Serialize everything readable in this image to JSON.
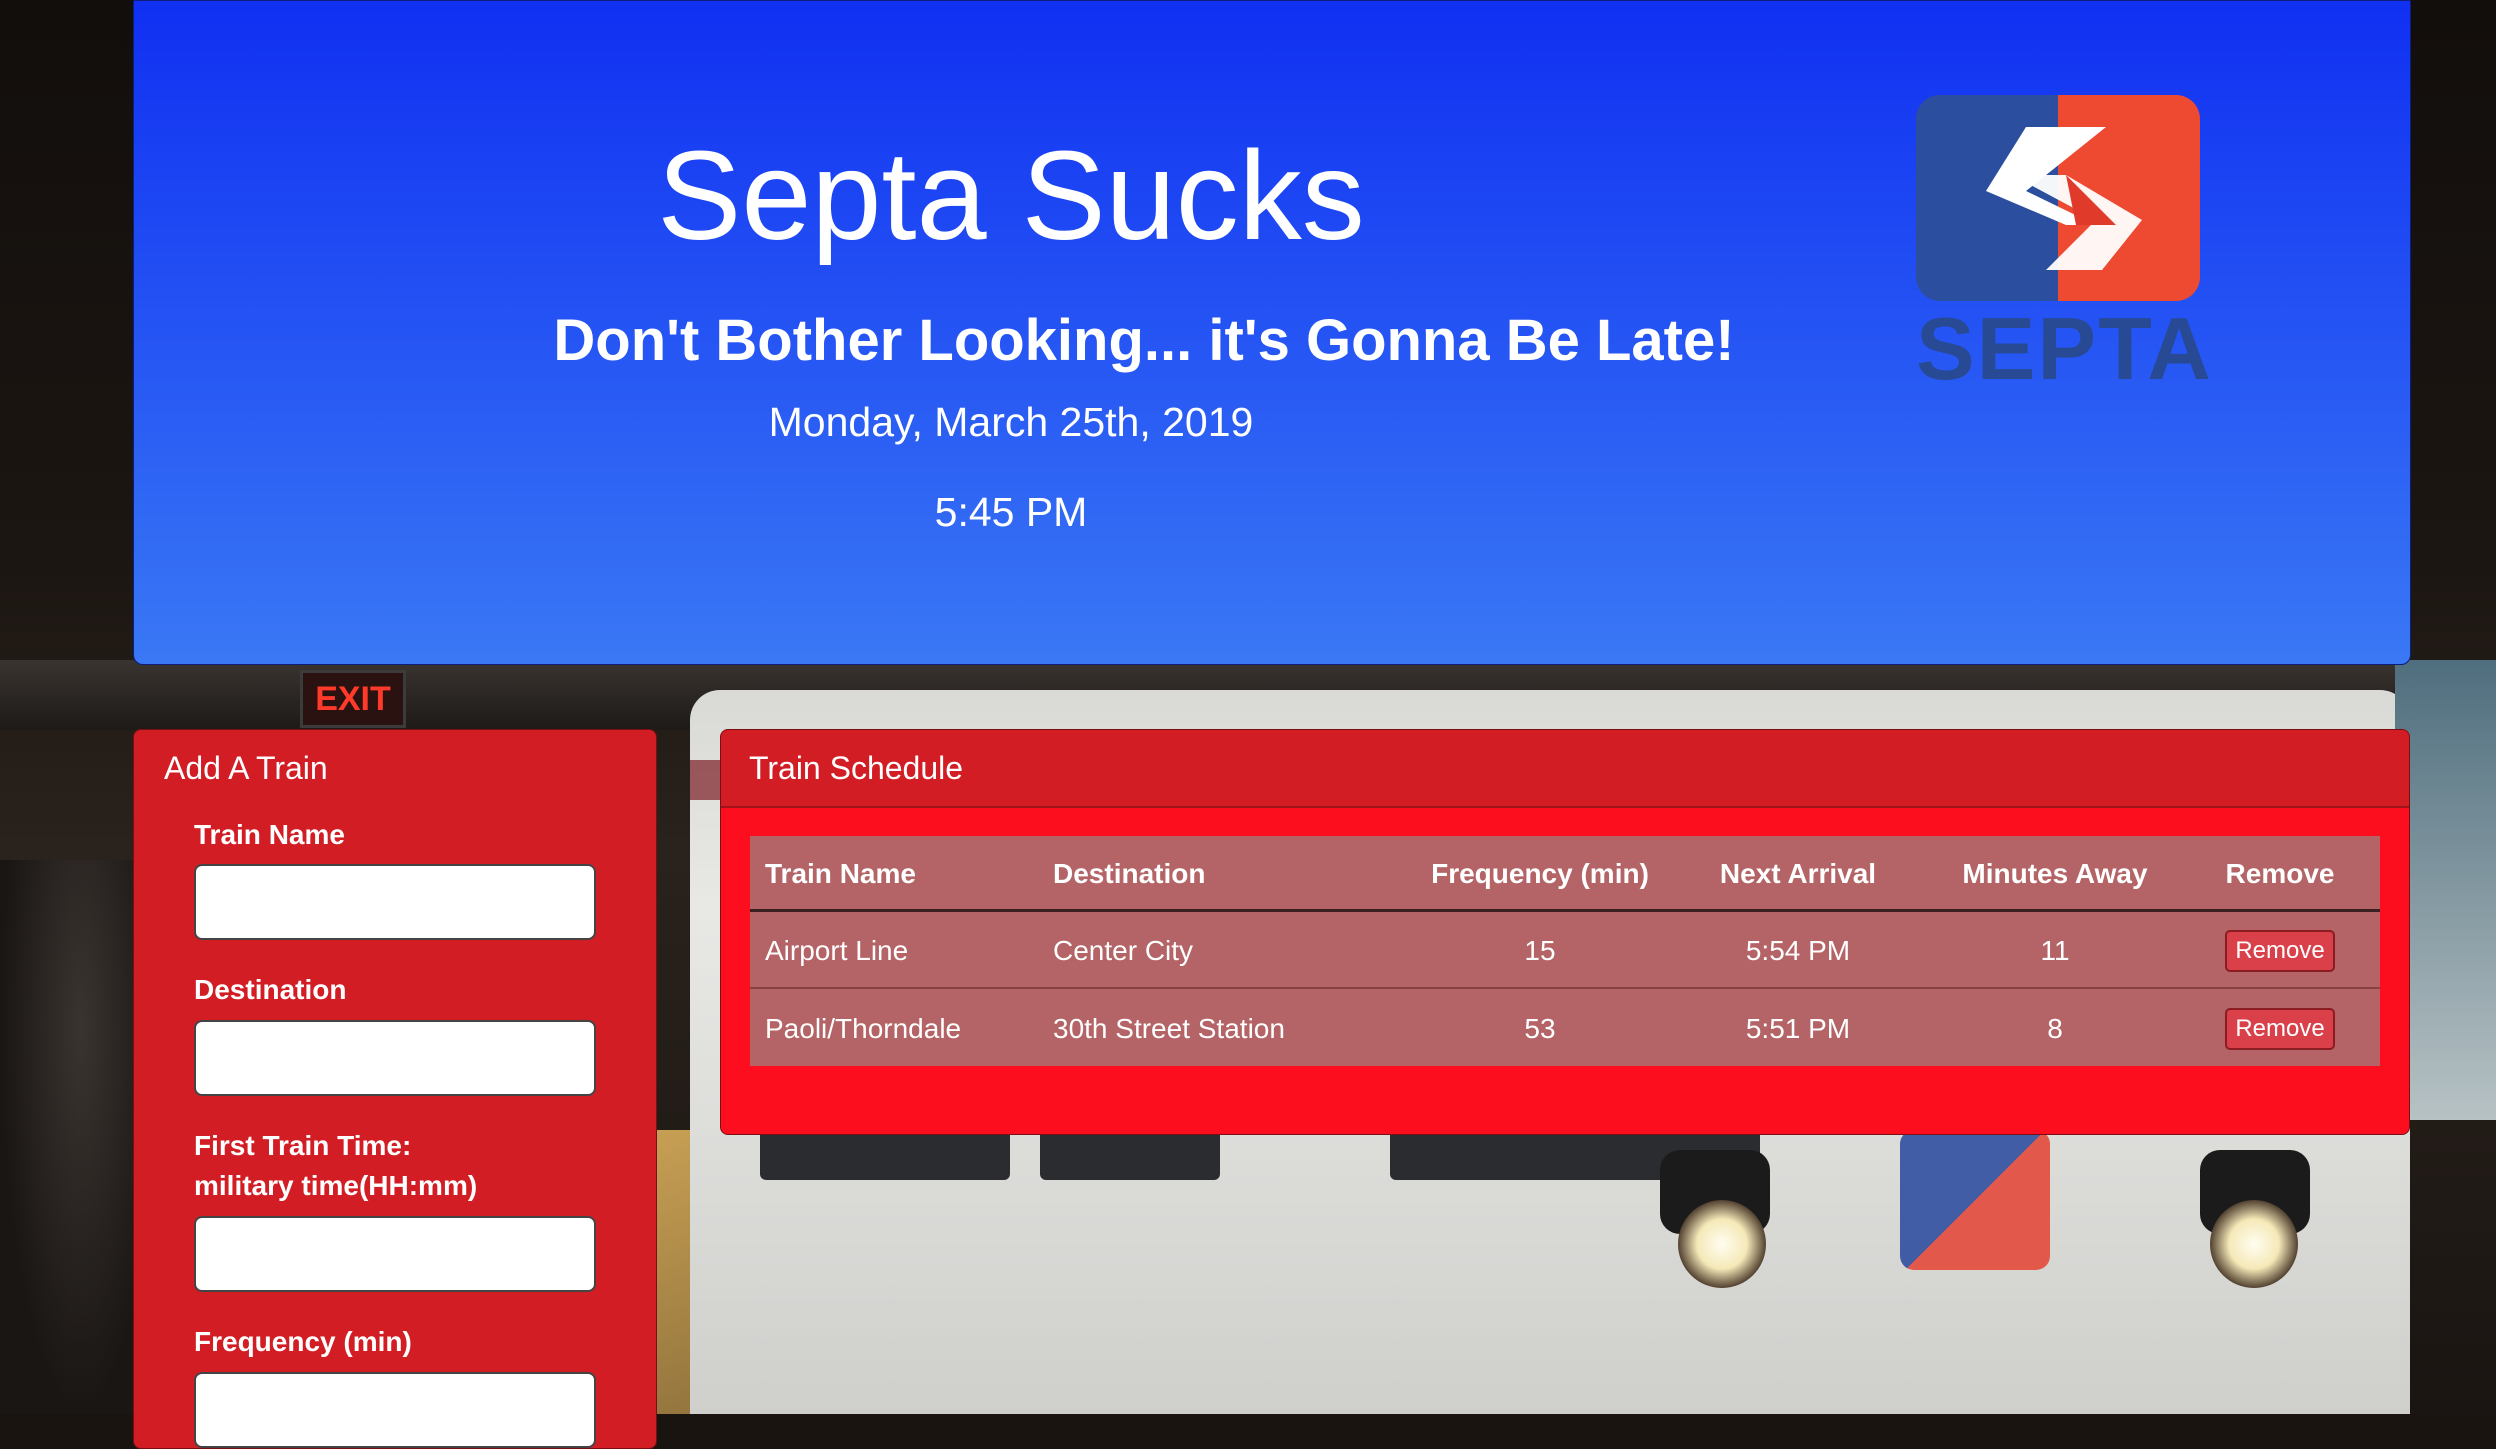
{
  "header": {
    "title": "Septa Sucks",
    "subtitle": "Don't Bother Looking... it's Gonna Be Late!",
    "date": "Monday, March 25th, 2019",
    "time": "5:45 PM",
    "logo_text": "SEPTA",
    "logo_icon": "septa-logo-icon"
  },
  "background": {
    "exit_sign": "EXIT"
  },
  "add_train": {
    "title": "Add A Train",
    "fields": [
      {
        "label": "Train Name",
        "value": ""
      },
      {
        "label": "Destination",
        "value": ""
      },
      {
        "label_line1": "First Train Time:",
        "label_line2": "military time(HH:mm)",
        "value": ""
      },
      {
        "label": "Frequency (min)",
        "value": ""
      }
    ]
  },
  "schedule": {
    "title": "Train Schedule",
    "columns": [
      "Train Name",
      "Destination",
      "Frequency (min)",
      "Next Arrival",
      "Minutes Away",
      "Remove"
    ],
    "rows": [
      {
        "train_name": "Airport Line",
        "destination": "Center City",
        "frequency": "15",
        "next_arrival": "5:54 PM",
        "minutes_away": "11",
        "remove_label": "Remove"
      },
      {
        "train_name": "Paoli/Thorndale",
        "destination": "30th Street Station",
        "frequency": "53",
        "next_arrival": "5:51 PM",
        "minutes_away": "8",
        "remove_label": "Remove"
      }
    ]
  },
  "colors": {
    "header_top": "#1030f2",
    "header_bottom": "#3a78f5",
    "panel_red": "#d21d24",
    "schedule_bg": "#fd0e1e",
    "table_bg": "#b46466"
  }
}
